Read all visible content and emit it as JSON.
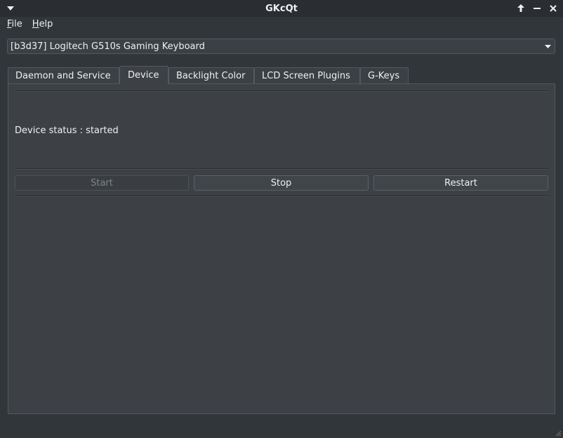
{
  "window": {
    "title": "GKcQt"
  },
  "menubar": {
    "items": [
      {
        "label": "File"
      },
      {
        "label": "Help"
      }
    ]
  },
  "device_select": {
    "value": "[b3d37] Logitech G510s Gaming Keyboard"
  },
  "tabs": [
    {
      "label": "Daemon and Service",
      "active": false
    },
    {
      "label": "Device",
      "active": true
    },
    {
      "label": "Backlight Color",
      "active": false
    },
    {
      "label": "LCD Screen Plugins",
      "active": false
    },
    {
      "label": "G-Keys",
      "active": false
    }
  ],
  "device_tab": {
    "status_text": "Device status : started",
    "start_label": "Start",
    "stop_label": "Stop",
    "restart_label": "Restart"
  },
  "icons": {
    "window_menu": "chevron-down-icon",
    "keep_above": "arrow-up-icon",
    "minimize": "minimize-icon",
    "close": "close-icon",
    "combo_arrow": "dropdown-arrow-icon",
    "resize_grip": "resize-grip-icon"
  },
  "colors": {
    "window_bg": "#31363b",
    "panel_bg": "#3d4145",
    "text": "#eff0f1",
    "disabled_text": "#7f8489"
  }
}
